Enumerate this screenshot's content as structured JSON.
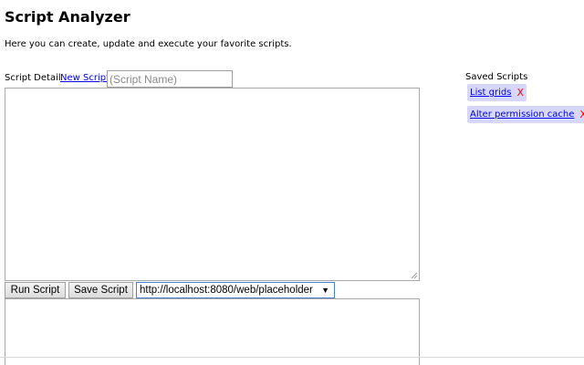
{
  "header": {
    "title": "Script Analyzer",
    "subtitle": "Here you can create, update and execute your favorite scripts."
  },
  "detail": {
    "label": "Script Detail",
    "new_script_link": "New Script",
    "name_placeholder": "(Script Name)",
    "name_value": "",
    "script_text": "",
    "output_text": ""
  },
  "toolbar": {
    "run_label": "Run Script",
    "save_label": "Save Script",
    "url_selected": "http://localhost:8080/web/placeholder"
  },
  "saved": {
    "heading": "Saved Scripts",
    "items": [
      {
        "label": "List grids",
        "delete": "X"
      },
      {
        "label": "Alter permission cache",
        "delete": "X"
      }
    ]
  },
  "colors": {
    "link": "#0000ee",
    "saved_item_bg": "#d7d7fb",
    "delete": "#ff0000",
    "select_border": "#4a7fd6"
  },
  "icons": {
    "select_caret": "▼"
  }
}
